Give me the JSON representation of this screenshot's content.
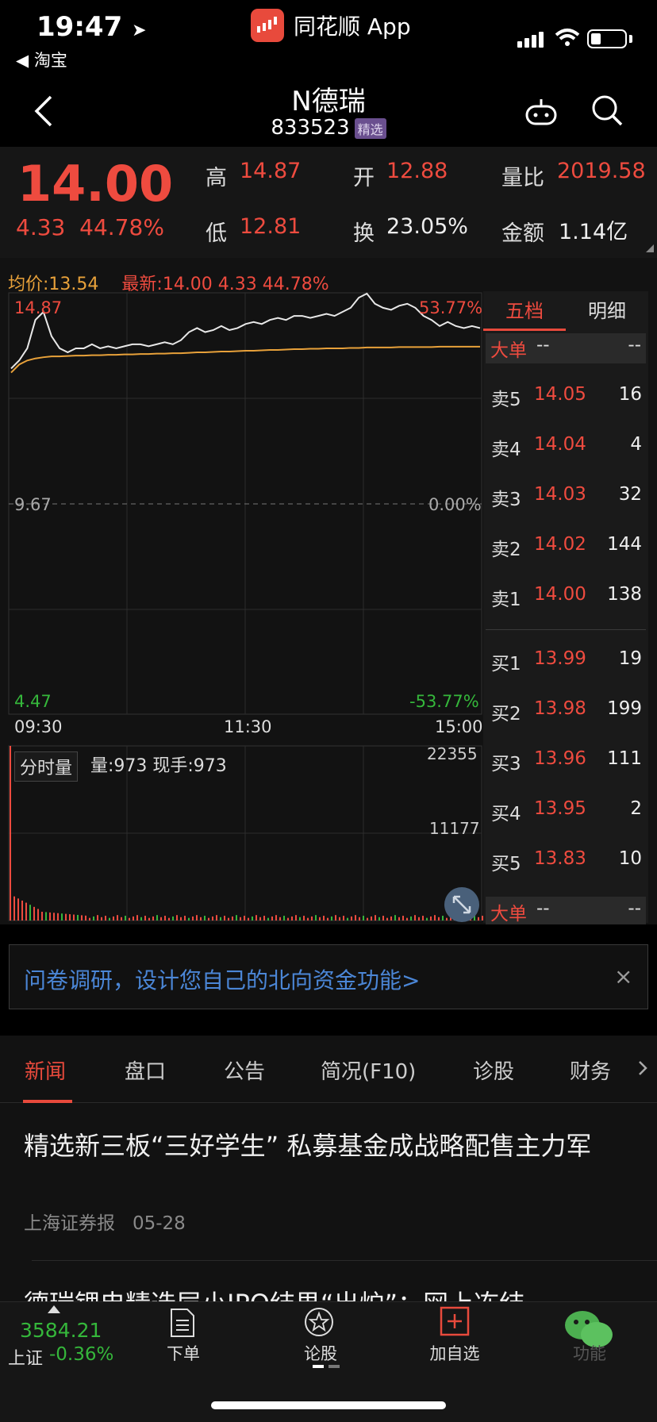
{
  "status_bar": {
    "time": "19:47",
    "back_app": "◀ 淘宝",
    "app_name": "同花顺 App"
  },
  "stock": {
    "name": "N德瑞",
    "code": "833523",
    "tag": "精选"
  },
  "quote": {
    "last": "14.00",
    "change": "4.33",
    "change_pct": "44.78%",
    "high_label": "高",
    "high": "14.87",
    "low_label": "低",
    "low": "12.81",
    "open_label": "开",
    "open": "12.88",
    "turnover_label": "换",
    "turnover": "23.05%",
    "vol_ratio_label": "量比",
    "vol_ratio": "2019.58",
    "amount_label": "金额",
    "amount": "1.14亿"
  },
  "chart_header": {
    "avg": "均价:13.54",
    "latest": "最新:14.00  4.33  44.78%"
  },
  "chart_labels": {
    "top_price": "14.87",
    "top_pct": "53.77%",
    "mid_price": "9.67",
    "mid_pct": "0.00%",
    "bottom_price": "4.47",
    "bottom_pct": "-53.77%",
    "t_start": "09:30",
    "t_mid": "11:30",
    "t_end": "15:00",
    "vol_tag": "分时量",
    "vol_info": "量:973 现手:973",
    "vol_max": "22355",
    "vol_mid": "11177"
  },
  "chart_data": {
    "type": "line",
    "y_range": [
      4.47,
      14.87
    ],
    "base": 9.67,
    "price": [
      13.0,
      13.2,
      13.5,
      14.2,
      14.4,
      13.8,
      13.5,
      13.4,
      13.5,
      13.5,
      13.6,
      13.5,
      13.55,
      13.5,
      13.55,
      13.6,
      13.6,
      13.55,
      13.6,
      13.65,
      13.6,
      13.7,
      13.9,
      14.0,
      13.9,
      13.95,
      14.05,
      13.95,
      14.0,
      14.1,
      14.15,
      14.1,
      14.2,
      14.25,
      14.2,
      14.3,
      14.3,
      14.25,
      14.3,
      14.35,
      14.3,
      14.4,
      14.5,
      14.75,
      14.85,
      14.6,
      14.5,
      14.45,
      14.55,
      14.6,
      14.5,
      14.3,
      14.2,
      14.05,
      14.15,
      14.05,
      14.0,
      14.05,
      14.0
    ],
    "avg": [
      12.9,
      13.1,
      13.2,
      13.25,
      13.28,
      13.3,
      13.3,
      13.31,
      13.32,
      13.32,
      13.33,
      13.33,
      13.34,
      13.34,
      13.35,
      13.35,
      13.36,
      13.36,
      13.37,
      13.37,
      13.38,
      13.38,
      13.39,
      13.4,
      13.4,
      13.41,
      13.42,
      13.42,
      13.43,
      13.44,
      13.44,
      13.45,
      13.46,
      13.46,
      13.47,
      13.48,
      13.48,
      13.49,
      13.49,
      13.5,
      13.5,
      13.5,
      13.51,
      13.51,
      13.52,
      13.52,
      13.52,
      13.52,
      13.53,
      13.53,
      13.53,
      13.53,
      13.53,
      13.54,
      13.54,
      13.54,
      13.54,
      13.54,
      13.54
    ],
    "volume_max": 22355
  },
  "order_book": {
    "tab_active": "五档",
    "tab_other": "明细",
    "big_label": "大单",
    "dash": "--",
    "asks": [
      {
        "label": "卖5",
        "price": "14.05",
        "vol": "16"
      },
      {
        "label": "卖4",
        "price": "14.04",
        "vol": "4"
      },
      {
        "label": "卖3",
        "price": "14.03",
        "vol": "32"
      },
      {
        "label": "卖2",
        "price": "14.02",
        "vol": "144"
      },
      {
        "label": "卖1",
        "price": "14.00",
        "vol": "138"
      }
    ],
    "bids": [
      {
        "label": "买1",
        "price": "13.99",
        "vol": "19"
      },
      {
        "label": "买2",
        "price": "13.98",
        "vol": "199"
      },
      {
        "label": "买3",
        "price": "13.96",
        "vol": "111"
      },
      {
        "label": "买4",
        "price": "13.95",
        "vol": "2"
      },
      {
        "label": "买5",
        "price": "13.83",
        "vol": "10"
      }
    ]
  },
  "survey": {
    "text": "问卷调研，设计您自己的北向资金功能>",
    "close": "×"
  },
  "tabs": [
    "新闻",
    "盘口",
    "公告",
    "简况(F10)",
    "诊股",
    "财务"
  ],
  "news": {
    "title": "精选新三板“三好学生” 私募基金成战略配售主力军",
    "source": "上海证券报",
    "date": "05-28",
    "title2": "德瑞锂电精选层小IPO结果“出炉”：网上冻结"
  },
  "bottom_bar": {
    "index_value": "3584.21",
    "index_name": "上证",
    "index_change": "-0.36%",
    "order": "下单",
    "forum": "论股",
    "add_watch": "加自选",
    "func": "功能"
  }
}
